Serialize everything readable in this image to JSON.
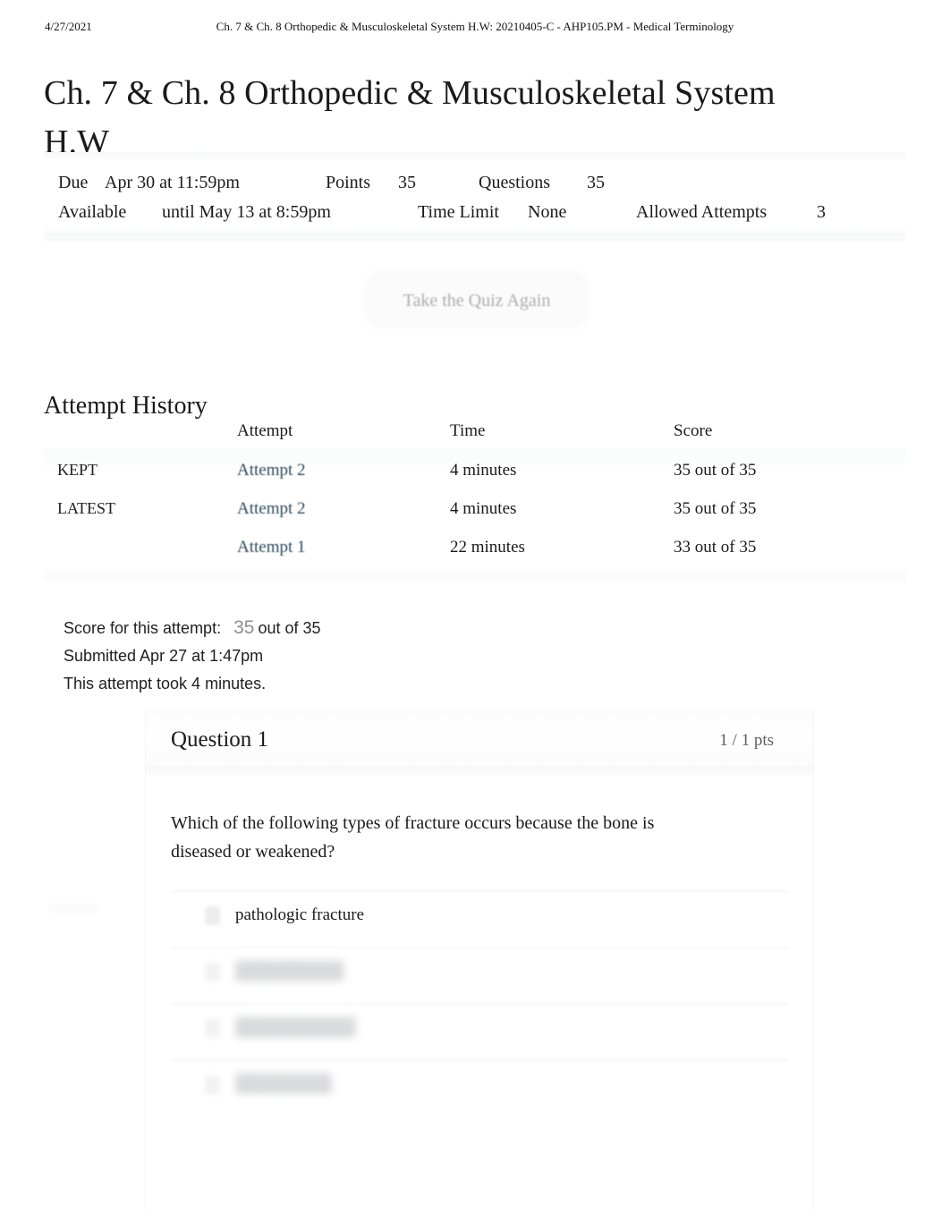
{
  "print_header": {
    "date": "4/27/2021",
    "title": "Ch. 7 & Ch. 8 Orthopedic & Musculoskeletal System H.W: 20210405-C - AHP105.PM - Medical Terminology"
  },
  "page_title": "Ch. 7 & Ch. 8 Orthopedic & Musculoskeletal System H.W",
  "meta": {
    "due_label": "Due",
    "due_value": "Apr 30 at 11:59pm",
    "points_label": "Points",
    "points_value": "35",
    "questions_label": "Questions",
    "questions_value": "35",
    "available_label": "Available",
    "available_value": "until May 13 at 8:59pm",
    "time_limit_label": "Time Limit",
    "time_limit_value": "None",
    "allowed_attempts_label": "Allowed Attempts",
    "allowed_attempts_value": "3"
  },
  "retake_button": {
    "label": "Take the Quiz Again"
  },
  "attempt_history": {
    "heading": "Attempt History",
    "columns": [
      "",
      "Attempt",
      "Time",
      "Score"
    ],
    "rows": [
      {
        "flag": "KEPT",
        "attempt": "Attempt 2",
        "time": "4 minutes",
        "score": "35 out of 35"
      },
      {
        "flag": "LATEST",
        "attempt": "Attempt 2",
        "time": "4 minutes",
        "score": "35 out of 35"
      },
      {
        "flag": "",
        "attempt": "Attempt 1",
        "time": "22 minutes",
        "score": "33 out of 35"
      }
    ]
  },
  "score_summary": {
    "score_label": "Score for this attempt:",
    "score_value": "35",
    "score_out_of": "out of 35",
    "submitted": "Submitted Apr 27 at 1:47pm",
    "duration": "This attempt took 4 minutes."
  },
  "question": {
    "title": "Question 1",
    "points": "1 / 1 pts",
    "text": "Which of the following types of fracture occurs because the bone is diseased or weakened?",
    "correct_marker": "Correct!",
    "answers": [
      {
        "label": "pathologic fracture",
        "blurred": false
      },
      {
        "label": "",
        "blurred": true
      },
      {
        "label": "",
        "blurred": true
      },
      {
        "label": "",
        "blurred": true
      }
    ]
  },
  "colors": {
    "link": "#2d4a5e",
    "text": "#1a1a1a",
    "muted": "#5e5e5e",
    "faded": "#adadad"
  }
}
